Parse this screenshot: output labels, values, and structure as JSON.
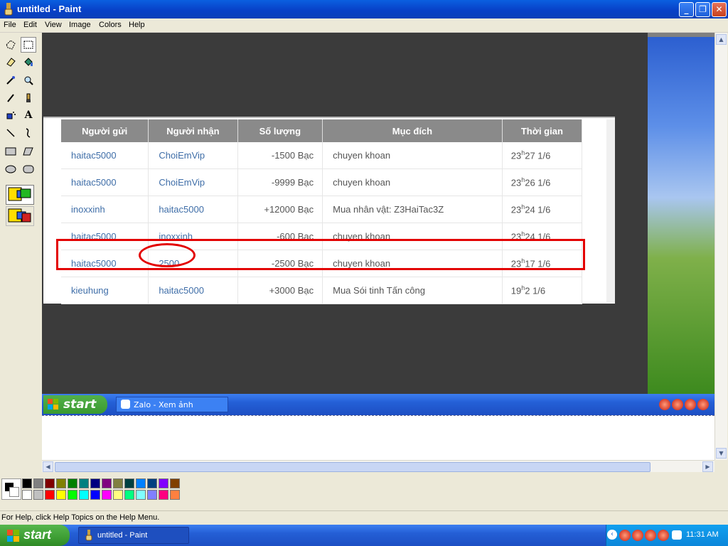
{
  "window": {
    "title": "untitled - Paint"
  },
  "menu": [
    "File",
    "Edit",
    "View",
    "Image",
    "Colors",
    "Help"
  ],
  "table": {
    "headers": [
      "Người gửi",
      "Người nhận",
      "Số lượng",
      "Mục đích",
      "Thời gian"
    ],
    "rows": [
      {
        "sender": "haitac5000",
        "receiver": "ChoiEmVip",
        "amount": "-1500  Bạc",
        "purpose": "chuyen khoan",
        "time": "23h27 1/6"
      },
      {
        "sender": "haitac5000",
        "receiver": "ChoiEmVip",
        "amount": "-9999  Bạc",
        "purpose": "chuyen khoan",
        "time": "23h26 1/6"
      },
      {
        "sender": "inoxxinh",
        "receiver": "haitac5000",
        "amount": "+12000  Bạc",
        "purpose": "Mua nhân vật: Z3HaiTac3Z",
        "time": "23h24 1/6"
      },
      {
        "sender": "haitac5000",
        "receiver": "inoxxinh",
        "amount": "-600  Bạc",
        "purpose": "chuyen khoan",
        "time": "23h24 1/6"
      },
      {
        "sender": "haitac5000",
        "receiver": "2500",
        "amount": "-2500  Bạc",
        "purpose": "chuyen khoan",
        "time": "23h17 1/6"
      },
      {
        "sender": "kieuhung",
        "receiver": "haitac5000",
        "amount": "+3000  Bạc",
        "purpose": "Mua Sói tinh Tấn công",
        "time": "19h2 1/6"
      }
    ]
  },
  "inner_taskbar": {
    "start_label": "start",
    "task_label": "Zalo - Xem ảnh"
  },
  "status": {
    "text": "For Help, click Help Topics on the Help Menu."
  },
  "taskbar": {
    "start_label": "start",
    "task_label": "untitled - Paint",
    "clock": "11:31 AM"
  },
  "colors": {
    "accent_red": "#e30000",
    "palette": [
      "#000000",
      "#808080",
      "#800000",
      "#808000",
      "#008000",
      "#008080",
      "#000080",
      "#800080",
      "#808040",
      "#004040",
      "#0080ff",
      "#004080",
      "#8000ff",
      "#804000",
      "#ffffff",
      "#c0c0c0",
      "#ff0000",
      "#ffff00",
      "#00ff00",
      "#00ffff",
      "#0000ff",
      "#ff00ff",
      "#ffff80",
      "#00ff80",
      "#80ffff",
      "#8080ff",
      "#ff0080",
      "#ff8040"
    ]
  }
}
